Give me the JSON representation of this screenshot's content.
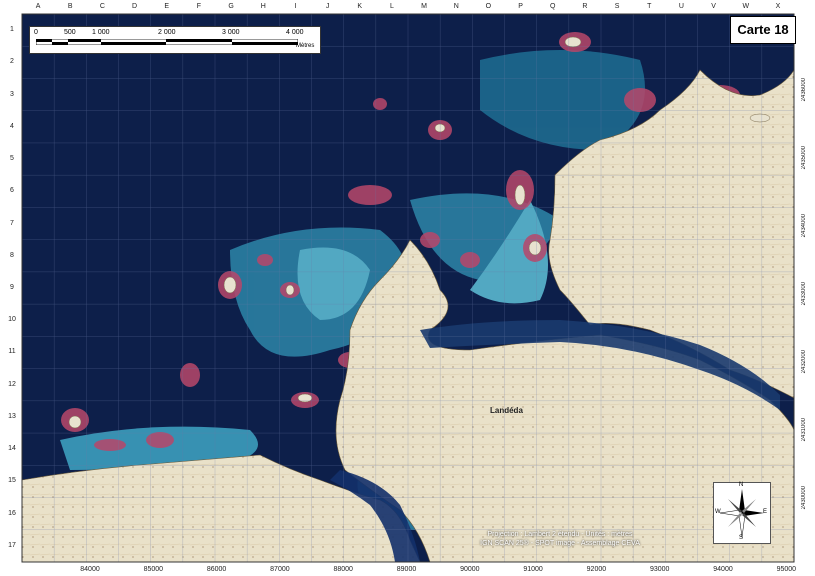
{
  "map": {
    "title": "Carte 18",
    "columns": [
      "A",
      "B",
      "C",
      "D",
      "E",
      "F",
      "G",
      "H",
      "I",
      "J",
      "K",
      "L",
      "M",
      "N",
      "O",
      "P",
      "Q",
      "R",
      "S",
      "T",
      "U",
      "V",
      "W",
      "X"
    ],
    "rows": [
      "1",
      "2",
      "3",
      "4",
      "5",
      "6",
      "7",
      "8",
      "9",
      "10",
      "11",
      "12",
      "13",
      "14",
      "15",
      "16",
      "17"
    ],
    "x_coords": [
      "84000",
      "85000",
      "86000",
      "87000",
      "88000",
      "89000",
      "90000",
      "91000",
      "92000",
      "93000",
      "94000",
      "95000"
    ],
    "y_coords": [
      "2436000",
      "2435000",
      "2434000",
      "2433000",
      "2432000",
      "2431000",
      "2430000"
    ],
    "place_label": "Landéda",
    "credits": [
      "Projection : Lambert 2 étendu - Unités : mètres",
      "IGN SCAN 25® - SPOT image - Assemblage CEVA"
    ]
  },
  "scale_bar": {
    "labels": [
      "0",
      "500",
      "1 000",
      "2 000",
      "3 000",
      "4 000"
    ],
    "unit": "Mètres"
  },
  "compass": {
    "north": "N",
    "south": "S",
    "east": "E",
    "west": "W"
  },
  "colors": {
    "sea_deep": "#0d1f4a",
    "sea_shallow": "#3fa6c4",
    "algae": "#b8476a",
    "land": "#e8e0c8",
    "grid": "#6b7aa6"
  }
}
